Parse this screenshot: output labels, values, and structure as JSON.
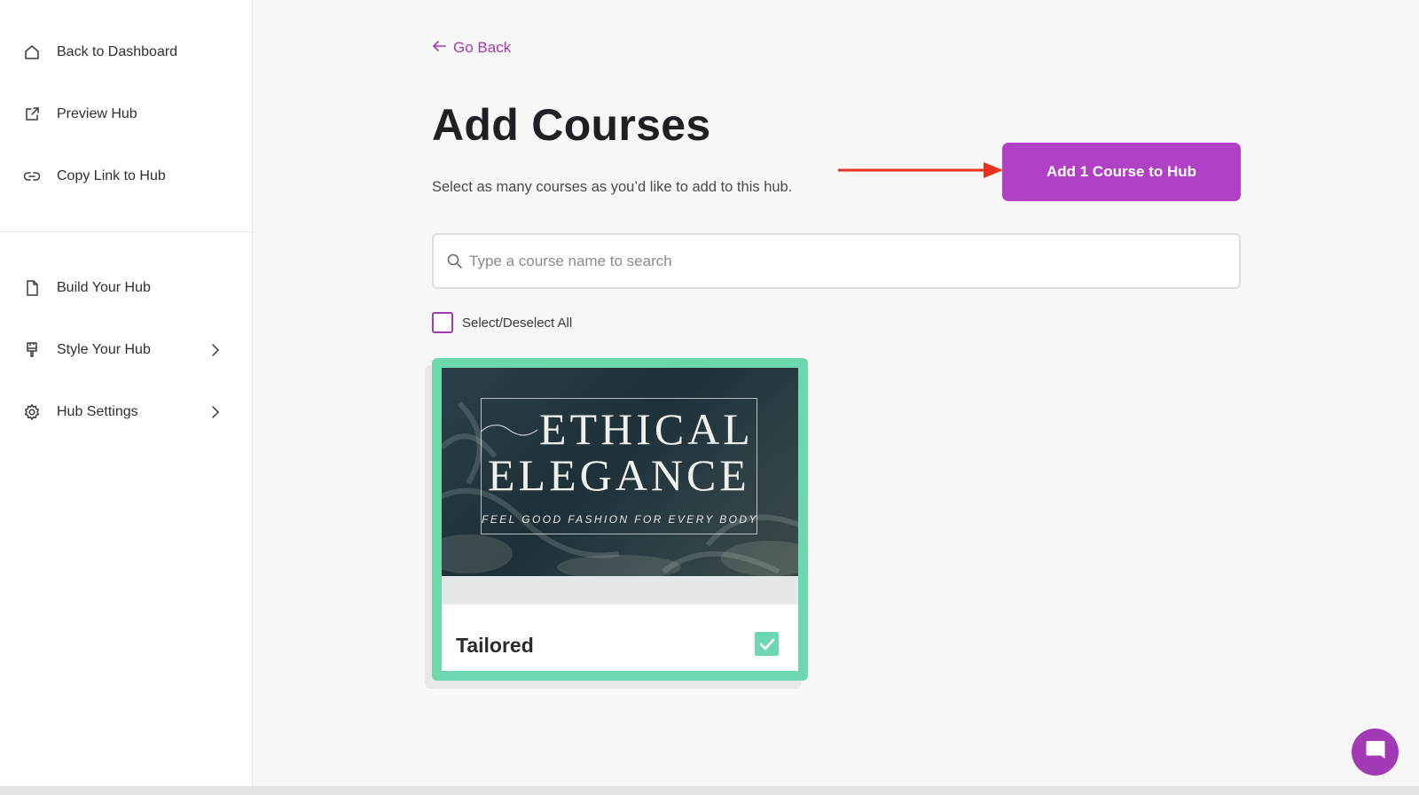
{
  "sidebar": {
    "top_items": [
      {
        "label": "Back to Dashboard",
        "icon": "home-icon"
      },
      {
        "label": "Preview Hub",
        "icon": "external-link-icon"
      },
      {
        "label": "Copy Link to Hub",
        "icon": "link-icon"
      }
    ],
    "bottom_items": [
      {
        "label": "Build Your Hub",
        "icon": "document-icon"
      },
      {
        "label": "Style Your Hub",
        "icon": "paint-brush-icon",
        "chevron": true
      },
      {
        "label": "Hub Settings",
        "icon": "gear-icon",
        "chevron": true
      }
    ]
  },
  "header": {
    "go_back": "Go Back",
    "title": "Add Courses",
    "subtitle": "Select as many courses as you’d like to add to this hub."
  },
  "actions": {
    "add_button": "Add 1 Course to Hub"
  },
  "search": {
    "placeholder": "Type a course name to search",
    "value": ""
  },
  "select_all": {
    "label": "Select/Deselect All",
    "checked": false
  },
  "courses": [
    {
      "title": "Tailored",
      "selected": true,
      "image_text": {
        "line1": "ETHICAL",
        "line2": "ELEGANCE",
        "tagline": "FEEL GOOD FASHION FOR EVERY BODY"
      }
    }
  ],
  "colors": {
    "accent": "#b040c4",
    "link": "#a23ab5",
    "selected_border": "#6dd7b0",
    "annotation_arrow": "#e8321e"
  }
}
